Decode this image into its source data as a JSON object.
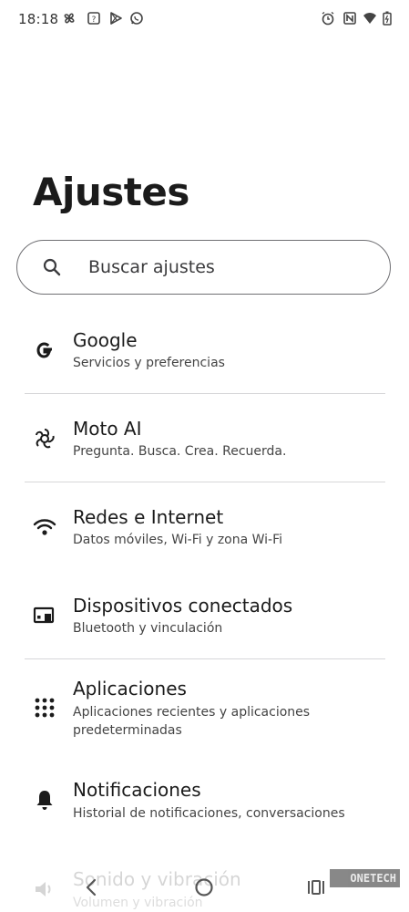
{
  "status_bar": {
    "time": "18:18",
    "icons_left": [
      "fan-icon",
      "app-icon",
      "play-store-icon",
      "whatsapp-icon"
    ],
    "icons_right": [
      "alarm-icon",
      "nfc-icon",
      "wifi-icon",
      "battery-icon"
    ]
  },
  "page": {
    "title": "Ajustes"
  },
  "search": {
    "placeholder": "Buscar ajustes",
    "icon": "search-icon"
  },
  "settings": [
    {
      "title": "Google",
      "subtitle": "Servicios y preferencias",
      "icon": "google-icon"
    },
    {
      "title": "Moto AI",
      "subtitle": "Pregunta. Busca. Crea. Recuerda.",
      "icon": "moto-ai-icon"
    },
    {
      "title": "Redes e Internet",
      "subtitle": "Datos móviles, Wi-Fi y zona Wi-Fi",
      "icon": "wifi-icon"
    },
    {
      "title": "Dispositivos conectados",
      "subtitle": "Bluetooth y vinculación",
      "icon": "devices-icon"
    },
    {
      "title": "Aplicaciones",
      "subtitle": "Aplicaciones recientes y aplicaciones predeterminadas",
      "icon": "apps-grid-icon"
    },
    {
      "title": "Notificaciones",
      "subtitle": "Historial de notificaciones, conversaciones",
      "icon": "bell-icon"
    },
    {
      "title": "Sonido y vibración",
      "subtitle": "Volumen y vibración",
      "icon": "speaker-icon"
    }
  ],
  "watermark": "ONETECH",
  "nav_bar": {
    "icons": [
      "back-icon",
      "home-icon",
      "recents-icon"
    ]
  }
}
